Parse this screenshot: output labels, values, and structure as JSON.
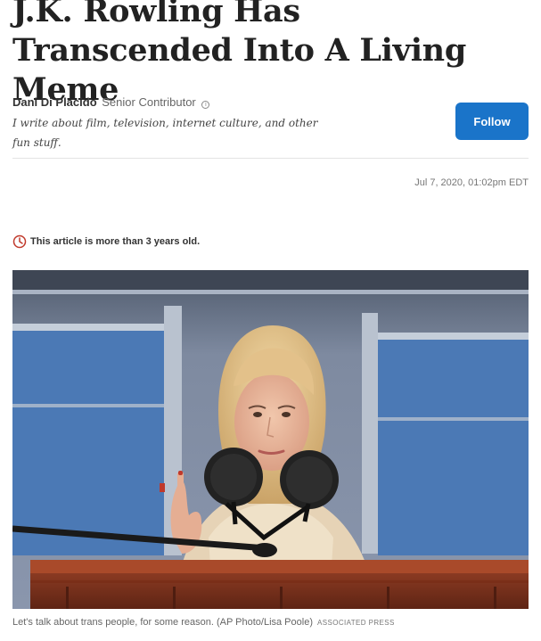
{
  "article": {
    "headline": "J.K. Rowling Has Transcended Into A Living Meme"
  },
  "author": {
    "name": "Dani Di Placido",
    "role": "Senior Contributor",
    "bio": "I write about film, television, internet culture, and other fun stuff.",
    "follow_label": "Follow",
    "info_icon": "info-icon"
  },
  "meta": {
    "timestamp": "Jul 7, 2020, 01:02pm EDT",
    "old_notice": "This article is more than 3 years old.",
    "clock_icon": "clock-icon"
  },
  "image": {
    "caption": "Let's talk about trans people, for some reason. (AP Photo/Lisa Poole)",
    "credit": "ASSOCIATED PRESS"
  },
  "colors": {
    "accent": "#1a74c9",
    "notice_icon": "#c0392b"
  }
}
